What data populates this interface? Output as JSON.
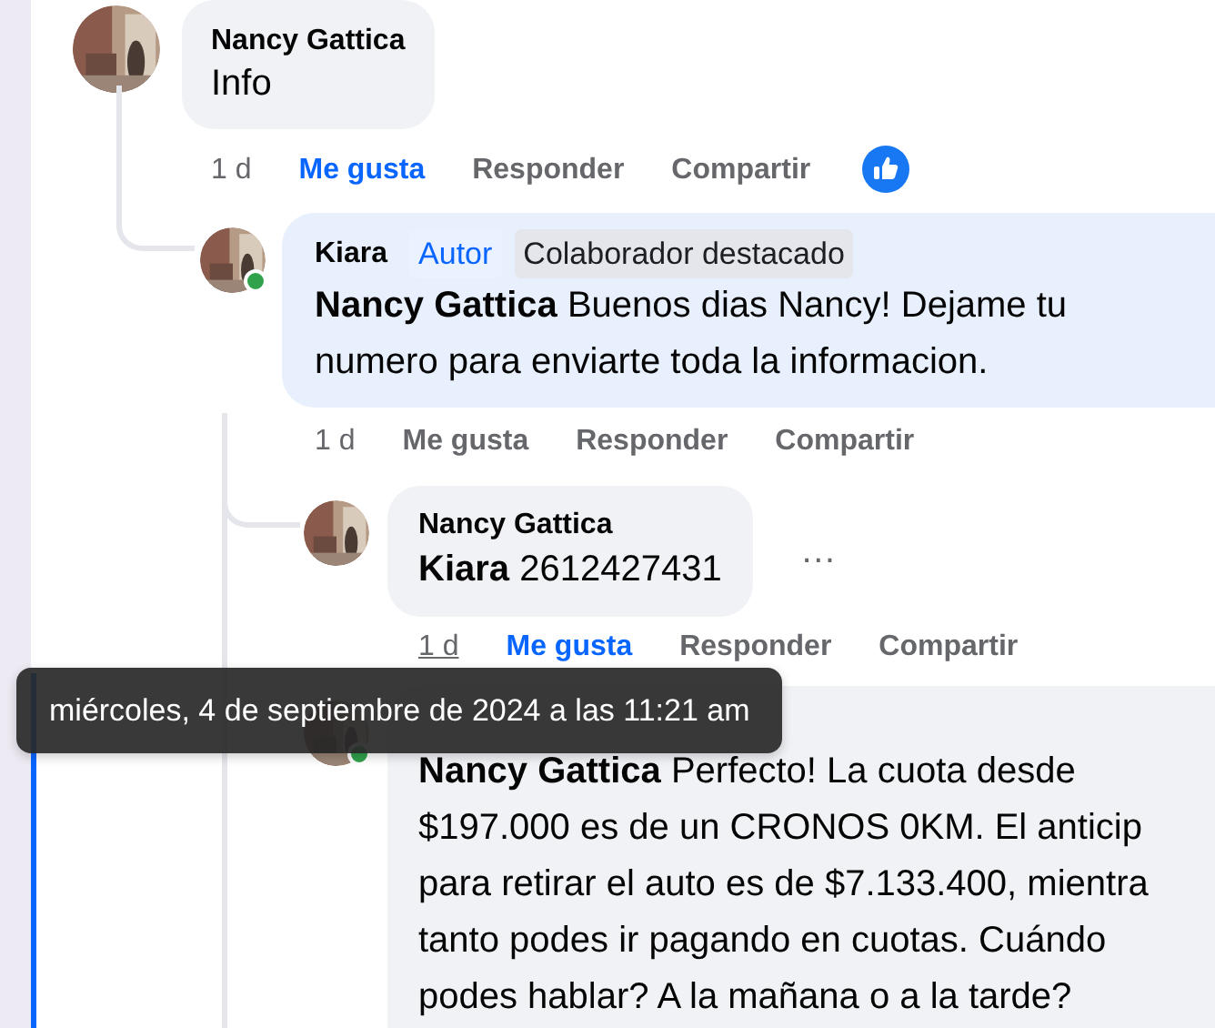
{
  "comments": [
    {
      "author": "Nancy Gattica",
      "online": false,
      "lines": [
        "Info"
      ],
      "actions": [
        {
          "kind": "time",
          "label": "1 d",
          "hovered": false
        },
        {
          "kind": "like",
          "label": "Me gusta",
          "selected": true
        },
        {
          "kind": "reply",
          "label": "Responder"
        },
        {
          "kind": "share",
          "label": "Compartir"
        }
      ],
      "reacted": true,
      "children": [
        {
          "author": "Kiara",
          "online": true,
          "badges": [
            {
              "kind": "author",
              "label": "Autor"
            },
            {
              "kind": "contributor",
              "label": "Colaborador destacado"
            }
          ],
          "highlighted": true,
          "lines": [
            "**Nancy Gattica** Buenos dias Nancy! Dejame tu",
            "numero para enviarte toda la informacion."
          ],
          "actions": [
            {
              "kind": "time",
              "label": "1 d",
              "hovered": false
            },
            {
              "kind": "like",
              "label": "Me gusta",
              "selected": false
            },
            {
              "kind": "reply",
              "label": "Responder"
            },
            {
              "kind": "share",
              "label": "Compartir"
            }
          ],
          "children": [
            {
              "author": "Nancy Gattica",
              "online": false,
              "lines": [
                "**Kiara** 2612427431"
              ],
              "more": "…",
              "actions": [
                {
                  "kind": "time",
                  "label": "1 d",
                  "hovered": true
                },
                {
                  "kind": "like",
                  "label": "Me gusta",
                  "selected": true
                },
                {
                  "kind": "reply",
                  "label": "Responder"
                },
                {
                  "kind": "share",
                  "label": "Compartir"
                }
              ]
            },
            {
              "online": true,
              "lines": [
                "**Nancy Gattica** Perfecto! La cuota desde",
                "$197.000 es de un CRONOS 0KM. El anticip",
                "para retirar el auto es de $7.133.400, mientra",
                "tanto podes ir pagando en cuotas. Cuándo",
                "podes hablar? A la mañana o a la tarde?"
              ]
            }
          ]
        }
      ]
    }
  ],
  "tooltip": {
    "text": "miércoles, 4 de septiembre de 2024 a las 11:21 am"
  }
}
